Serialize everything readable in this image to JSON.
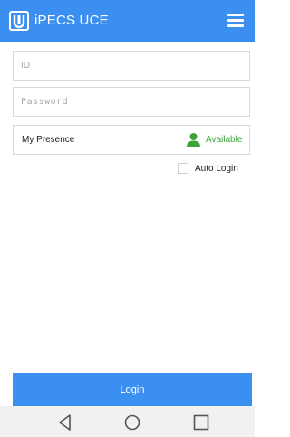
{
  "header": {
    "title": "iPECS UCE",
    "logo_icon": "ipecs-logo-icon",
    "menu_icon": "hamburger-menu-icon",
    "background_color": "#3b8ff0"
  },
  "login_form": {
    "id_placeholder": "ID",
    "id_value": "",
    "password_placeholder": "Password",
    "password_value": "",
    "presence": {
      "label": "My Presence",
      "status": "Available",
      "status_icon": "user-presence-icon",
      "status_color": "#3aa33a"
    },
    "auto_login": {
      "label": "Auto Login",
      "checked": false
    },
    "login_button_label": "Login"
  },
  "system_nav": {
    "back_icon": "back-triangle-icon",
    "home_icon": "home-circle-icon",
    "recents_icon": "recents-square-icon"
  }
}
